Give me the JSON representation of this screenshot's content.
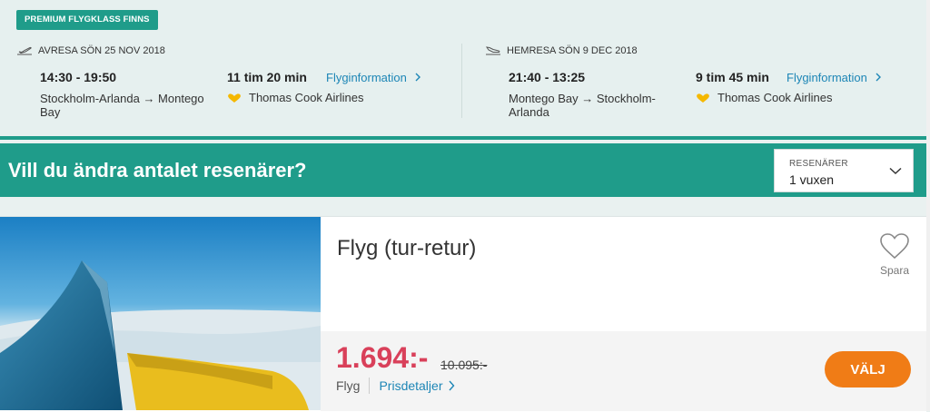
{
  "badge": "PREMIUM FLYGKLASS FINNS",
  "outbound": {
    "header": "AVRESA SÖN 25 NOV 2018",
    "times": "14:30 - 19:50",
    "route": "Stockholm-Arlanda → Montego Bay",
    "duration": "11 tim 20 min",
    "info_link": "Flyginformation",
    "airline": "Thomas Cook Airlines",
    "icon": "plane-takeoff-icon"
  },
  "return": {
    "header": "HEMRESA SÖN 9 DEC 2018",
    "times": "21:40 - 13:25",
    "route": "Montego Bay → Stockholm-Arlanda",
    "duration": "9 tim 45 min",
    "info_link": "Flyginformation",
    "airline": "Thomas Cook Airlines",
    "icon": "plane-landing-icon"
  },
  "travelers": {
    "question": "Vill du ändra antalet resenärer?",
    "select_label": "RESENÄRER",
    "select_value": "1 vuxen"
  },
  "product": {
    "title": "Flyg (tur-retur)",
    "save_label": "Spara",
    "price": "1.694:-",
    "old_price": "10.095:-",
    "type": "Flyg",
    "price_details_link": "Prisdetaljer",
    "select_button": "VÄLJ"
  },
  "colors": {
    "brand_teal": "#1f9c8a",
    "price_red": "#d9405a",
    "cta_orange": "#f07c16",
    "link_blue": "#1d86b6"
  }
}
